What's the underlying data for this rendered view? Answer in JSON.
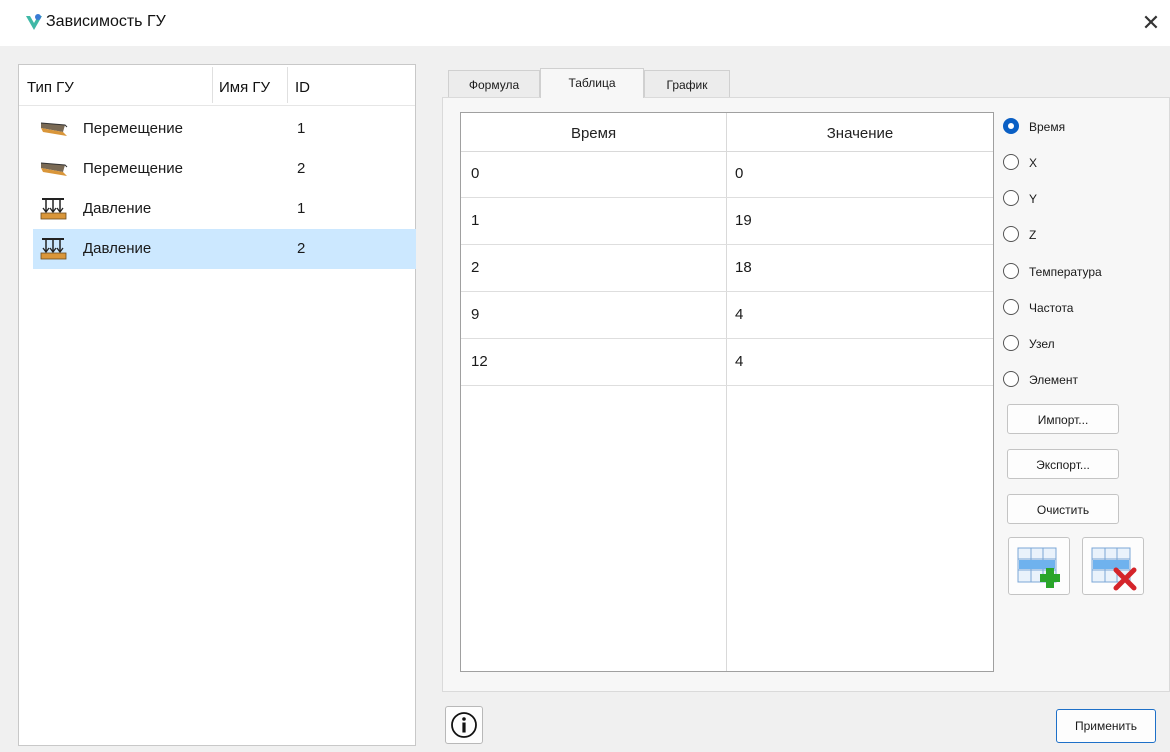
{
  "window": {
    "title": "Зависимость ГУ",
    "close_label": "✕"
  },
  "list": {
    "columns": [
      "Тип ГУ",
      "Имя ГУ",
      "ID"
    ],
    "rows": [
      {
        "type": "Перемещение",
        "icon": "displacement-icon",
        "name": "",
        "id": "1"
      },
      {
        "type": "Перемещение",
        "icon": "displacement-icon",
        "name": "",
        "id": "2"
      },
      {
        "type": "Давление",
        "icon": "pressure-icon",
        "name": "",
        "id": "1"
      },
      {
        "type": "Давление",
        "icon": "pressure-icon",
        "name": "",
        "id": "2",
        "selected": true
      }
    ]
  },
  "tabs": [
    {
      "label": "Формула",
      "active": false
    },
    {
      "label": "Таблица",
      "active": true
    },
    {
      "label": "График",
      "active": false
    }
  ],
  "table": {
    "headers": [
      "Время",
      "Значение"
    ],
    "rows": [
      [
        "0",
        "0"
      ],
      [
        "1",
        "19"
      ],
      [
        "2",
        "18"
      ],
      [
        "9",
        "4"
      ],
      [
        "12",
        "4"
      ]
    ]
  },
  "variables": {
    "options": [
      "Время",
      "X",
      "Y",
      "Z",
      "Температура",
      "Частота",
      "Узел",
      "Элемент"
    ],
    "selected": "Время"
  },
  "buttons": {
    "import": "Импорт...",
    "export": "Экспорт...",
    "clear": "Очистить",
    "add_row_icon": "add-row-icon",
    "delete_row_icon": "delete-row-icon",
    "info_icon": "info-icon",
    "apply": "Применить"
  },
  "colors": {
    "accent": "#0a5fc4",
    "selection": "#cce8ff"
  }
}
